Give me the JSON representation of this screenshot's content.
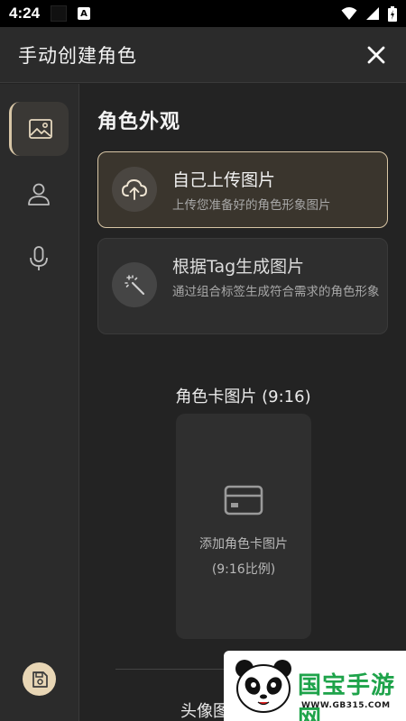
{
  "status_bar": {
    "time": "4:24",
    "app_icon_letter": "A"
  },
  "header": {
    "title": "手动创建角色",
    "close_icon": "close-icon"
  },
  "sidenav": {
    "items": [
      {
        "icon": "image-icon",
        "active": true
      },
      {
        "icon": "person-icon",
        "active": false
      },
      {
        "icon": "microphone-icon",
        "active": false
      }
    ],
    "save_icon": "save-icon"
  },
  "main": {
    "section_title": "角色外观",
    "options": [
      {
        "title": "自己上传图片",
        "desc": "上传您准备好的角色形象图片",
        "icon": "cloud-upload-icon",
        "selected": true
      },
      {
        "title": "根据Tag生成图片",
        "desc": "通过组合标签生成符合需求的角色形象",
        "icon": "magic-wand-icon",
        "selected": false
      }
    ],
    "card_image": {
      "label": "角色卡图片 (9:16)",
      "placeholder_line1": "添加角色卡图片",
      "placeholder_line2": "(9:16比例)",
      "icon": "card-icon"
    },
    "avatar_label": "头像图"
  },
  "watermark": {
    "text": "国宝手游网",
    "url": "WWW.GB315.COM"
  },
  "colors": {
    "accent": "#d8c6a6",
    "background": "#232323",
    "panel": "#2b2b2b",
    "watermark_green": "#1ea34a"
  }
}
